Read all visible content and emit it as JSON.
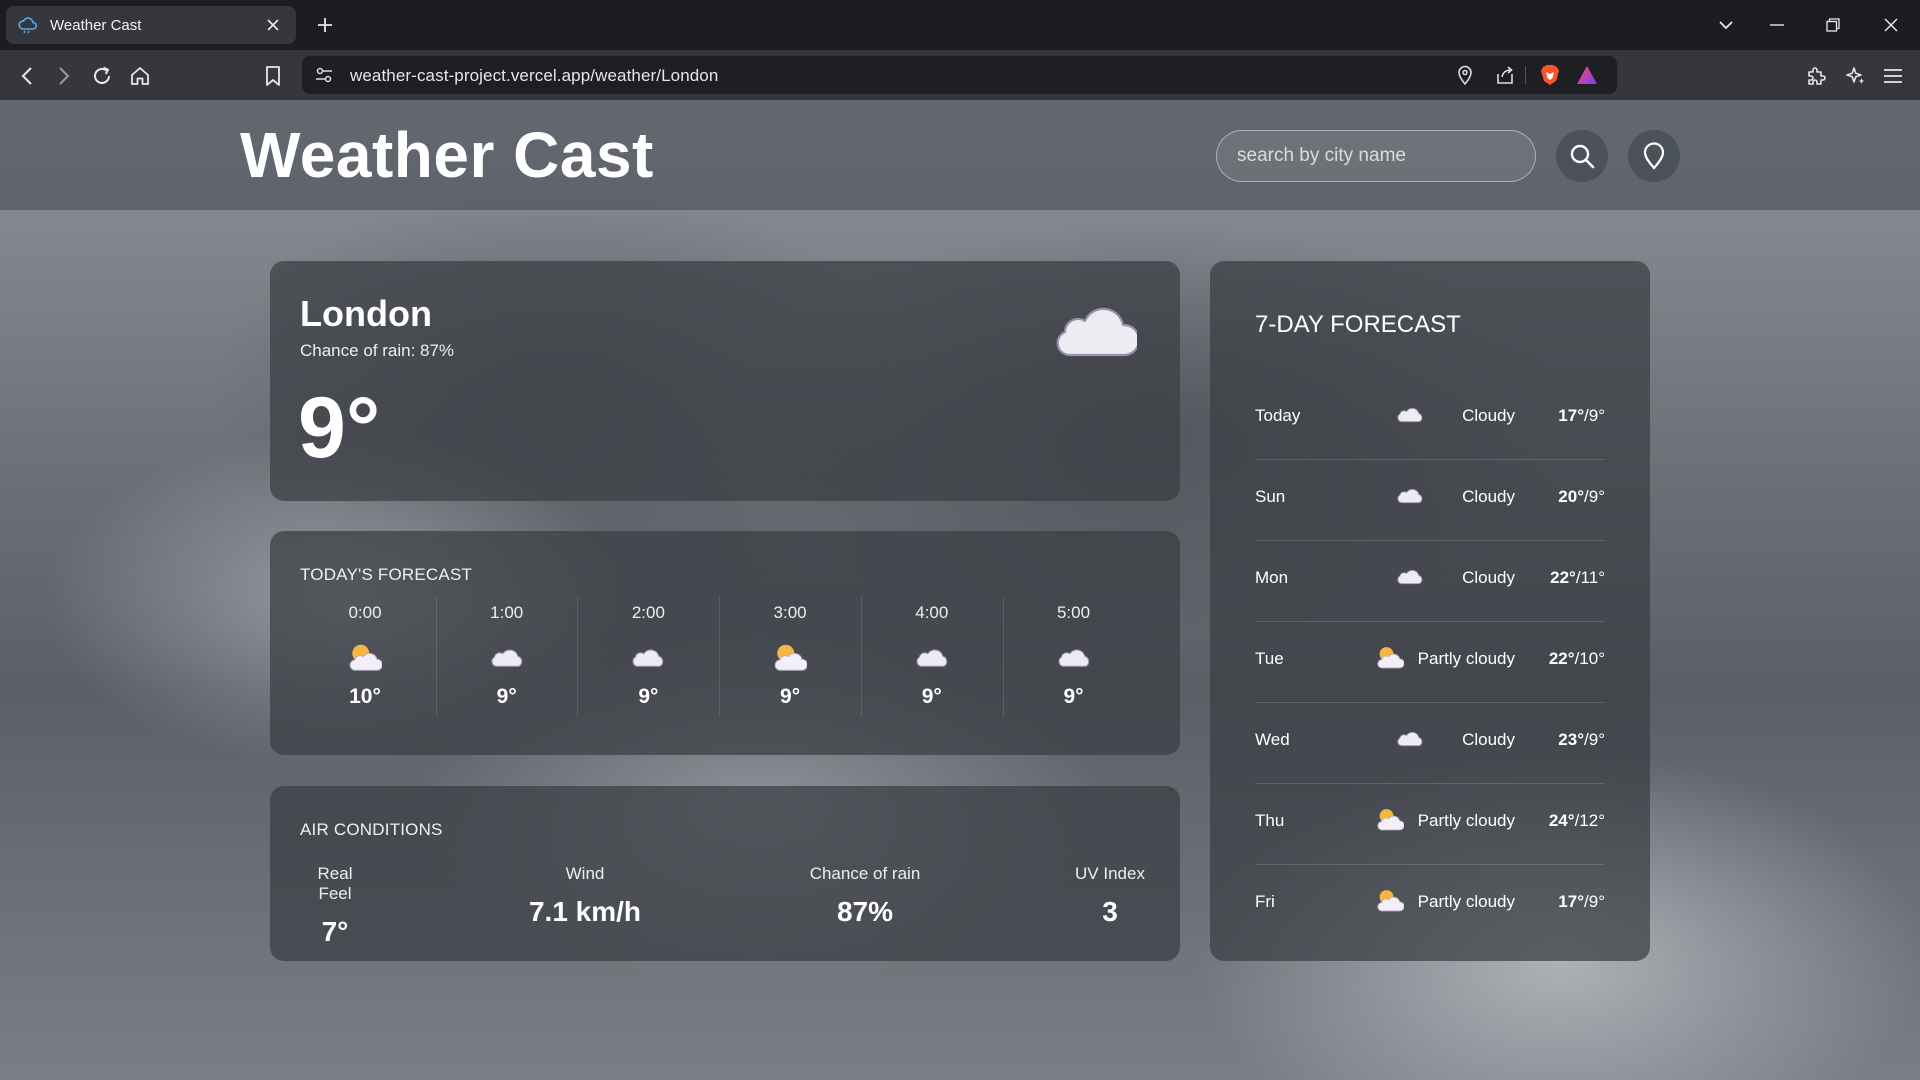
{
  "browser": {
    "tab_title": "Weather Cast",
    "url": "weather-cast-project.vercel.app/weather/London"
  },
  "header": {
    "title": "Weather Cast",
    "search_placeholder": "search by city name"
  },
  "current": {
    "city": "London",
    "chance_of_rain": "Chance of rain: 87%",
    "temperature": "9°",
    "icon": "cloud-icon"
  },
  "today": {
    "title": "TODAY'S FORECAST",
    "hours": [
      {
        "time": "0:00",
        "icon": "partly-cloudy-icon",
        "temp": "10°"
      },
      {
        "time": "1:00",
        "icon": "cloud-icon",
        "temp": "9°"
      },
      {
        "time": "2:00",
        "icon": "cloud-icon",
        "temp": "9°"
      },
      {
        "time": "3:00",
        "icon": "partly-cloudy-icon",
        "temp": "9°"
      },
      {
        "time": "4:00",
        "icon": "cloud-icon",
        "temp": "9°"
      },
      {
        "time": "5:00",
        "icon": "cloud-icon",
        "temp": "9°"
      }
    ]
  },
  "air": {
    "title": "AIR CONDITIONS",
    "items": [
      {
        "label": "Real Feel",
        "value": "7°"
      },
      {
        "label": "Wind",
        "value": "7.1 km/h"
      },
      {
        "label": "Chance of rain",
        "value": "87%"
      },
      {
        "label": "UV Index",
        "value": "3"
      }
    ]
  },
  "week": {
    "title": "7-DAY FORECAST",
    "days": [
      {
        "day": "Today",
        "icon": "cloud-icon",
        "condition": "Cloudy",
        "high": "17°",
        "low": "/9°"
      },
      {
        "day": "Sun",
        "icon": "cloud-icon",
        "condition": "Cloudy",
        "high": "20°",
        "low": "/9°"
      },
      {
        "day": "Mon",
        "icon": "cloud-icon",
        "condition": "Cloudy",
        "high": "22°",
        "low": "/11°"
      },
      {
        "day": "Tue",
        "icon": "partly-cloudy-icon",
        "condition": "Partly cloudy",
        "high": "22°",
        "low": "/10°"
      },
      {
        "day": "Wed",
        "icon": "cloud-icon",
        "condition": "Cloudy",
        "high": "23°",
        "low": "/9°"
      },
      {
        "day": "Thu",
        "icon": "partly-cloudy-icon",
        "condition": "Partly cloudy",
        "high": "24°",
        "low": "/12°"
      },
      {
        "day": "Fri",
        "icon": "partly-cloudy-icon",
        "condition": "Partly cloudy",
        "high": "17°",
        "low": "/9°"
      }
    ]
  },
  "colors": {
    "accent_brave": "#fb542b",
    "sun": "#f6b740",
    "cloud": "#eeebf3"
  }
}
